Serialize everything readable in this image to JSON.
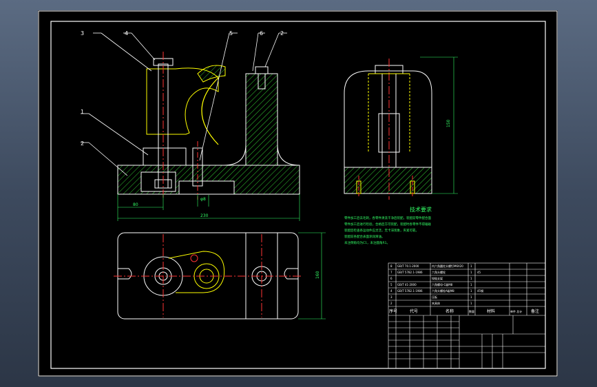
{
  "drawing": {
    "part_callouts": [
      "3",
      "4",
      "5",
      "6",
      "2",
      "1",
      "2"
    ],
    "dimensions": {
      "front_left_offset": "80",
      "front_total_width": "230",
      "front_small": "φ8",
      "side_height": "150",
      "top_height": "160"
    },
    "tech_requirements": {
      "title": "技术要求",
      "lines": [
        "零件加工后去毛刺，各零件清洗干净后装配，装配前零件配合面",
        "零件加工后进行检验，合格后方可装配，装配时各零件不得磕碰",
        "装配后检查各运动件应灵活，无卡滞现象，夹紧可靠。",
        "装配前各配合表面涂润滑油。",
        "未注倒角均为C1，未注圆角R1。"
      ]
    },
    "bom": {
      "rows": [
        {
          "no": "8",
          "code": "GB/T 70.1-2000",
          "name": "内六角圆柱头螺钉M6X20",
          "qty": "1",
          "material": ""
        },
        {
          "no": "7",
          "code": "GB/T 5782.1-1986",
          "name": "六角头螺栓",
          "qty": "1",
          "material": "45"
        },
        {
          "no": "6",
          "code": "",
          "name": "铰链支架",
          "qty": "1",
          "material": ""
        },
        {
          "no": "5",
          "code": "GB/T 41-2000",
          "name": "六角螺母-C级M8",
          "qty": "1",
          "material": ""
        },
        {
          "no": "4",
          "code": "GB/T 5782.1-1986",
          "name": "六角头螺栓A级M8",
          "qty": "1",
          "material": "45钢"
        },
        {
          "no": "3",
          "code": "",
          "name": "压板",
          "qty": "1",
          "material": ""
        },
        {
          "no": "2",
          "code": "",
          "name": "夹具体",
          "qty": "1",
          "material": ""
        }
      ],
      "headers": {
        "no": "序号",
        "code": "代号",
        "name": "名称",
        "qty": "数量",
        "material": "材料",
        "weight": "单件 总计",
        "note": "备注"
      }
    }
  },
  "colors": {
    "background": "#000000",
    "frame": "#ffffff",
    "part_outline": "#ffffff",
    "hatch": "#33cc33",
    "centerline": "#ff3333",
    "highlight": "#ffff00",
    "leader": "#ffffff",
    "dimension": "#33ff66",
    "text_green": "#33ff66"
  }
}
